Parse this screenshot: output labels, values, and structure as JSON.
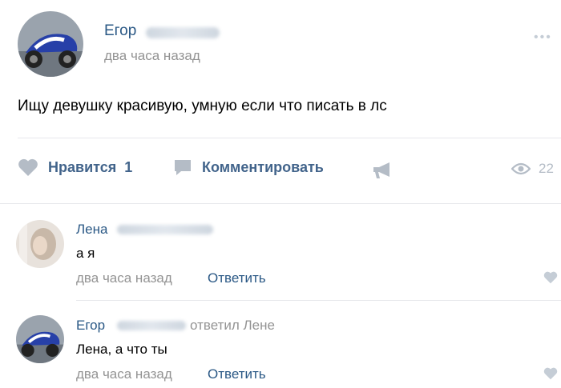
{
  "post": {
    "author_name": "Егор",
    "time": "два часа назад",
    "text": "Ищу девушку красивую, умную если что писать в лс",
    "more_label": "•••",
    "actions": {
      "like_label": "Нравится",
      "like_count": "1",
      "comment_label": "Комментировать",
      "views_count": "22"
    }
  },
  "comments": [
    {
      "author_name": "Лена",
      "text": "а я",
      "time": "два часа назад",
      "reply_label": "Ответить"
    },
    {
      "author_name": "Егор",
      "replied_to": "ответил Лене",
      "text": "Лена, а что ты",
      "time": "два часа назад",
      "reply_label": "Ответить"
    }
  ],
  "icons": {
    "like": "heart-icon",
    "comment": "comment-bubble-icon",
    "share": "megaphone-share-icon",
    "views": "eye-icon",
    "more": "more-dots-icon"
  },
  "colors": {
    "link": "#2a5885",
    "action": "#42648b",
    "icon": "#b4bcc6",
    "meta": "#939393"
  }
}
